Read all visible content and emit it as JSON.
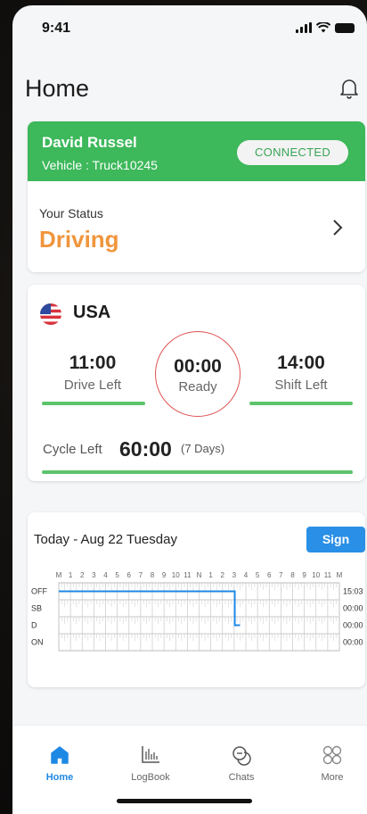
{
  "status_bar": {
    "time": "9:41"
  },
  "header": {
    "title": "Home"
  },
  "driver": {
    "name": "David Russel",
    "vehicle": "Vehicle : Truck10245",
    "connection": "CONNECTED",
    "status_label": "Your Status",
    "status_value": "Driving"
  },
  "clock": {
    "country": "USA",
    "drive_left": {
      "value": "11:00",
      "label": "Drive Left"
    },
    "ready": {
      "value": "00:00",
      "label": "Ready"
    },
    "shift_left": {
      "value": "14:00",
      "label": "Shift Left"
    },
    "cycle_label": "Cycle Left",
    "cycle_value": "60:00",
    "cycle_days": "(7 Days)"
  },
  "log": {
    "date": "Today - Aug 22 Tuesday",
    "sign_label": "Sign",
    "hour_labels": [
      "M",
      "1",
      "2",
      "3",
      "4",
      "5",
      "6",
      "7",
      "8",
      "9",
      "10",
      "11",
      "N",
      "1",
      "2",
      "3",
      "4",
      "5",
      "6",
      "7",
      "8",
      "9",
      "10",
      "11",
      "M"
    ],
    "rows": [
      {
        "status": "OFF",
        "total": "15:03"
      },
      {
        "status": "SB",
        "total": "00:00"
      },
      {
        "status": "D",
        "total": "00:00"
      },
      {
        "status": "ON",
        "total": "00:00"
      }
    ]
  },
  "nav": [
    {
      "label": "Home",
      "icon": "home-icon",
      "active": true
    },
    {
      "label": "LogBook",
      "icon": "logbook-icon",
      "active": false
    },
    {
      "label": "Chats",
      "icon": "chats-icon",
      "active": false
    },
    {
      "label": "More",
      "icon": "more-icon",
      "active": false
    }
  ],
  "colors": {
    "accent": "#1e88e5",
    "connected_green": "#3db85b",
    "driving_orange": "#f0953d",
    "ring_red": "#e05252"
  }
}
